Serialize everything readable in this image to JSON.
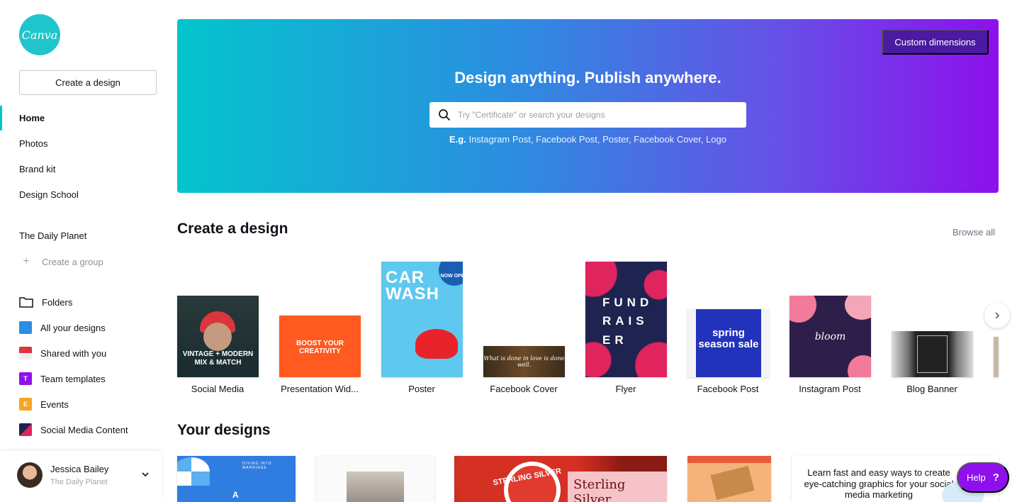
{
  "sidebar": {
    "logo_text": "Canva",
    "create_button": "Create a design",
    "nav": [
      {
        "label": "Home",
        "active": true
      },
      {
        "label": "Photos"
      },
      {
        "label": "Brand kit"
      },
      {
        "label": "Design School"
      }
    ],
    "team_name": "The Daily Planet",
    "create_group": "Create a group",
    "folders": [
      {
        "label": "Folders",
        "icon": "folder-icon"
      },
      {
        "label": "All your designs",
        "icon": "all-designs-icon",
        "color": "#2b8ee0"
      },
      {
        "label": "Shared with you",
        "icon": "shared-icon",
        "color": "#d9363e"
      },
      {
        "label": "Team templates",
        "icon": "team-templates-icon",
        "color": "#8d10ed",
        "letter": "T"
      },
      {
        "label": "Events",
        "icon": "events-icon",
        "color": "#f5a623",
        "letter": "E"
      },
      {
        "label": "Social Media Content",
        "icon": "social-media-content-icon",
        "color": "#1e2350"
      }
    ],
    "profile": {
      "name": "Jessica Bailey",
      "team": "The Daily Planet"
    }
  },
  "hero": {
    "title": "Design anything. Publish anywhere.",
    "custom_dimensions": "Custom dimensions",
    "search_placeholder": "Try \"Certificate\" or search your designs",
    "examples_prefix": "E.g.",
    "examples": [
      "Instagram Post",
      "Facebook Post",
      "Poster",
      "Facebook Cover",
      "Logo"
    ]
  },
  "create_section": {
    "title": "Create a design",
    "browse_all": "Browse all",
    "templates": [
      {
        "label": "Social Media",
        "art_text": "VINTAGE + MODERN MIX & MATCH"
      },
      {
        "label": "Presentation Wid...",
        "art_text": "BOOST YOUR CREATIVITY"
      },
      {
        "label": "Poster",
        "art_text": "CAR WASH",
        "badge": "NOW OPEN"
      },
      {
        "label": "Facebook Cover",
        "art_text": "What is done in love is done well."
      },
      {
        "label": "Flyer",
        "art_text": "FUND RAIS ER"
      },
      {
        "label": "Facebook Post",
        "art_text": "spring season sale"
      },
      {
        "label": "Instagram Post",
        "art_text": "bloom"
      },
      {
        "label": "Blog Banner"
      }
    ]
  },
  "your_designs": {
    "title": "Your designs",
    "items": [
      {
        "art_text": "DIVING INTO MARRIAGE",
        "art_letter": "A"
      },
      {},
      {
        "art_text": "STERLING SILVER",
        "art_title": "Sterling Silver"
      },
      {},
      {
        "art_text": "Learn fast and easy ways to create eye-catching graphics for your social media marketing"
      }
    ]
  },
  "help": {
    "label": "Help",
    "icon": "?"
  },
  "colors": {
    "brand": "#00c4cc",
    "accent": "#8d10ed"
  }
}
